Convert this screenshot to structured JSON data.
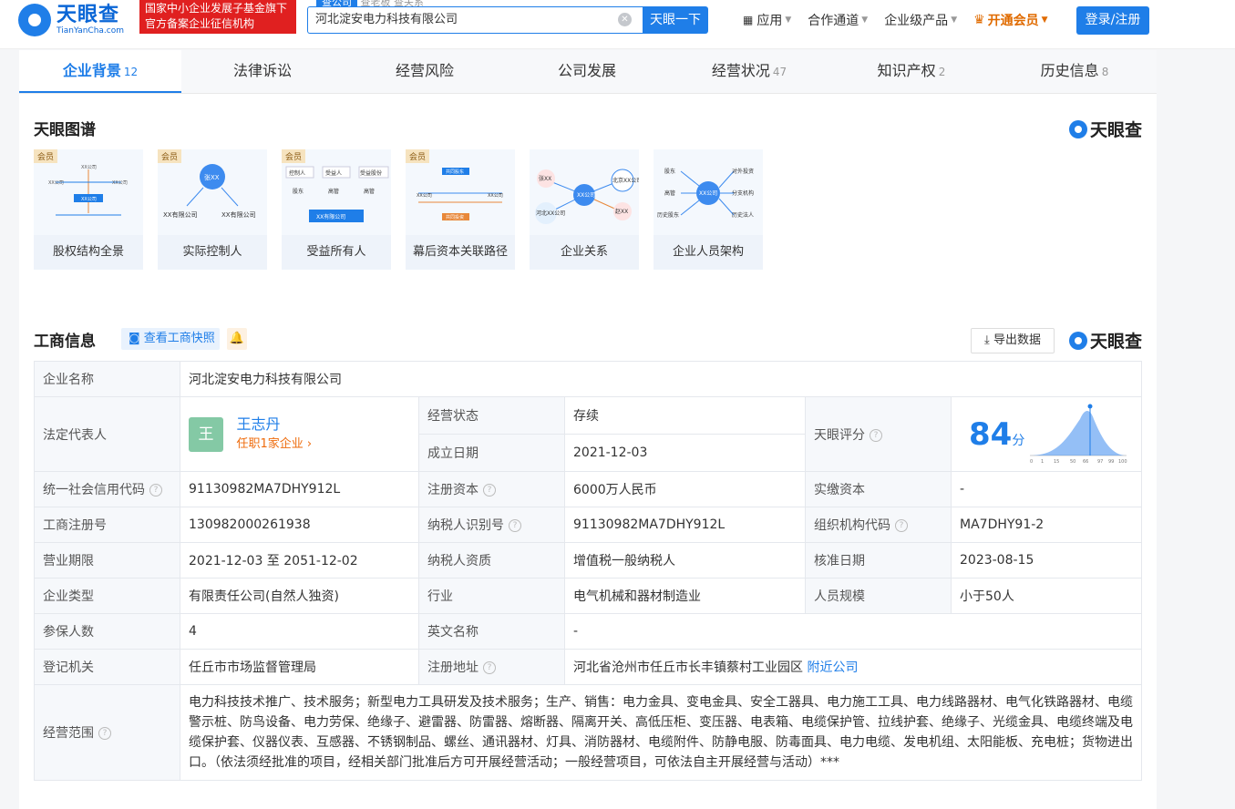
{
  "header": {
    "logo_text": "天眼查",
    "logo_sub": "TianYanCha.com",
    "badge_line1": "国家中小企业发展子基金旗下",
    "badge_line2": "官方备案企业征信机构",
    "search_tabs": [
      "查公司",
      "查老板",
      "查关系"
    ],
    "search_value": "河北淀安电力科技有限公司",
    "search_button": "天眼一下",
    "nav": [
      "应用",
      "合作通道",
      "企业级产品"
    ],
    "vip": "开通会员",
    "login": "登录/注册"
  },
  "tabs": [
    {
      "label": "企业背景",
      "count": "12"
    },
    {
      "label": "法律诉讼",
      "count": ""
    },
    {
      "label": "经营风险",
      "count": ""
    },
    {
      "label": "公司发展",
      "count": ""
    },
    {
      "label": "经营状况",
      "count": "47"
    },
    {
      "label": "知识产权",
      "count": "2"
    },
    {
      "label": "历史信息",
      "count": "8"
    }
  ],
  "graph_section": {
    "title": "天眼图谱",
    "brand": "天眼查",
    "member_tag": "会员",
    "cards": [
      "股权结构全景",
      "实际控制人",
      "受益所有人",
      "幕后资本关联路径",
      "企业关系",
      "企业人员架构"
    ],
    "thumb_text": {
      "c1": [
        "XX公司",
        "XX公司",
        "XX公司",
        "XX公司"
      ],
      "c2": [
        "张XX",
        "XX有限公司",
        "XX有限公司"
      ],
      "c3": [
        "控制人",
        "受益人",
        "受益股份",
        "股东",
        "高管",
        "高管",
        "XX有限公司"
      ],
      "c4": [
        "共同股东",
        "XX公司",
        "XX公司",
        "共同投资"
      ],
      "c5": [
        "张XX",
        "XX公司",
        "北京XX公司",
        "河北XX公司",
        "赵XX"
      ],
      "c6": [
        "股东",
        "高管",
        "历史股东",
        "XX公司",
        "对外投资",
        "分支机构",
        "历史法人"
      ]
    }
  },
  "info_section": {
    "title": "工商信息",
    "snapshot_btn": "查看工商快照",
    "export_btn": "导出数据",
    "brand": "天眼查"
  },
  "info": {
    "company_name_label": "企业名称",
    "company_name": "河北淀安电力科技有限公司",
    "legal_label": "法定代表人",
    "legal_avatar": "王",
    "legal_name": "王志丹",
    "legal_sub": "任职1家企业 ›",
    "status_label": "经营状态",
    "status": "存续",
    "founded_label": "成立日期",
    "founded": "2021-12-03",
    "score_label": "天眼评分",
    "score": "84",
    "score_unit": "分",
    "score_ticks": [
      "0",
      "1",
      "15",
      "50",
      "66",
      "97",
      "99",
      "100"
    ],
    "credit_label": "统一社会信用代码",
    "credit": "91130982MA7DHY912L",
    "capital_label": "注册资本",
    "capital": "6000万人民币",
    "paid_label": "实缴资本",
    "paid": "-",
    "reg_no_label": "工商注册号",
    "reg_no": "130982000261938",
    "tax_id_label": "纳税人识别号",
    "tax_id": "91130982MA7DHY912L",
    "org_code_label": "组织机构代码",
    "org_code": "MA7DHY91-2",
    "term_label": "营业期限",
    "term": "2021-12-03 至 2051-12-02",
    "tax_qual_label": "纳税人资质",
    "tax_qual": "增值税一般纳税人",
    "approve_label": "核准日期",
    "approve": "2023-08-15",
    "type_label": "企业类型",
    "type": "有限责任公司(自然人独资)",
    "industry_label": "行业",
    "industry": "电气机械和器材制造业",
    "staff_label": "人员规模",
    "staff": "小于50人",
    "insured_label": "参保人数",
    "insured": "4",
    "english_label": "英文名称",
    "english": "-",
    "authority_label": "登记机关",
    "authority": "任丘市市场监督管理局",
    "address_label": "注册地址",
    "address": "河北省沧州市任丘市长丰镇蔡村工业园区",
    "nearby": "附近公司",
    "scope_label": "经营范围",
    "scope": "电力科技技术推广、技术服务；新型电力工具研发及技术服务；生产、销售：电力金具、变电金具、安全工器具、电力施工工具、电力线路器材、电气化铁路器材、电缆警示桩、防鸟设备、电力劳保、绝缘子、避雷器、防雷器、熔断器、隔离开关、高低压柜、变压器、电表箱、电缆保护管、拉线护套、绝缘子、光缆金具、电缆终端及电缆保护套、仪器仪表、互感器、不锈钢制品、螺丝、通讯器材、灯具、消防器材、电缆附件、防静电服、防毒面具、电力电缆、发电机组、太阳能板、充电桩；货物进出口。（依法须经批准的项目，经相关部门批准后方可开展经营活动；一般经营项目，可依法自主开展经营与活动）***"
  }
}
